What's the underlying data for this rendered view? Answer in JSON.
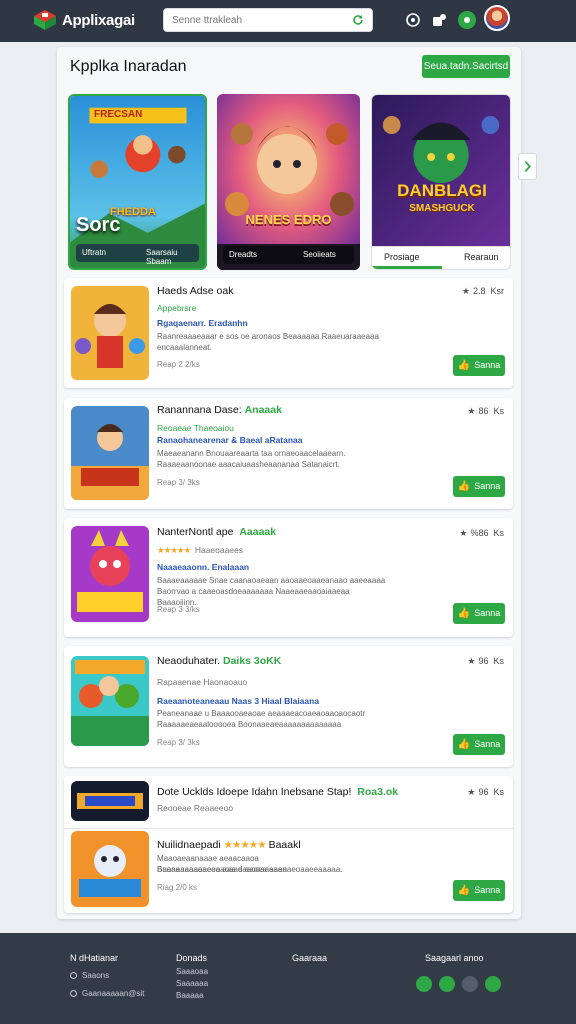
{
  "header": {
    "brand": "Applixagai",
    "search_placeholder": "Senne ttrakleah"
  },
  "main": {
    "title": "Kpplka Inaradan",
    "top_button": "Seua.tadn.Sacirtsd"
  },
  "featured": [
    {
      "banner": "FRECSAN",
      "logo": "FHEDDA",
      "big_text": "Sorc",
      "caption_left": "Uftratn",
      "caption_right": "Saarsaiu Sbaam"
    },
    {
      "logo": "NENES EDRO",
      "caption_left": "Dreadts",
      "caption_right": "Seoiieats"
    },
    {
      "logo_top": "DANBLAGI",
      "logo_bottom": "SMASHGUCK",
      "tab_active": "Prosiage",
      "tab_other": "Rearaun"
    }
  ],
  "apps": [
    {
      "name": "Haeds Adse oak",
      "highlight": "",
      "green": "Appebrsre",
      "blue": "Rgaqaenarr. Eradanhn",
      "desc1": "Raanreaaaeaaar e sos oe aronaos Beaaaaaa Raaeuaraaeaaa",
      "desc2": "encaaalanneat.",
      "size": "Reap 2 2/ks",
      "rating": "2.8",
      "rating_suffix": "Ksr",
      "button": "Sanna"
    },
    {
      "name": "Ranannana Dase:",
      "highlight": "Anaaak",
      "green": "Reoaeae  Thaeoaiou",
      "blue": "Ranaohanearenar & Baeal aRatanaa",
      "desc1": "Maeaeanann Bnouaareaarta taa ornaeoaacelaaearn.",
      "desc2": "Raaaeaanoonae aaacaiuaasheaananaa Satanaicrt.",
      "size": "Reap 3/ 3ks",
      "rating": "86",
      "rating_suffix": "Ks",
      "button": "Sanna"
    },
    {
      "name": "NanterNontl ape",
      "highlight": "Aaaaak",
      "stars_text": "★★★★★",
      "green": "Haaeoaaees",
      "blue": "Naaaeaaonn. Enalaaan",
      "desc1": "Baaaeaaaaae Snae caanaoaeaan aaoaaeoaaeanaao aaeeaaaa",
      "desc2": "Baorrvao a caaeoasdoeaaaaaaa Naaeaaeaaoaiaaeaa Baaaoiiinn.",
      "size": "Reap 3 3/ks",
      "rating": "%86",
      "rating_suffix": "Ks",
      "button": "Sanna"
    },
    {
      "name": "Neaoduhater.",
      "highlight": "Daiks 3oKK",
      "green": "Rapaaenae  Haonaoauo",
      "blue": "Raeaanoteaneaau  Naas 3 Hiaal Blaiaana",
      "desc1": "Peaneanaae u Baaaooaeaoae aeaaaeacoaeaoaaoaocaotr",
      "desc2": "Raaaaaeaeaalooooea  Boonaaeaeaaaaaaaaaaaaaa",
      "size": "Reap 3/ 3ks",
      "rating": "96",
      "rating_suffix": "Ks",
      "button": "Sanna"
    }
  ],
  "combo": {
    "top_name": "Dote Ucklds Idoepe Idahn Inebsane Stap!",
    "top_highlight": "Roa3.ok",
    "top_sub": "Reooeae  Reaaeeoo",
    "top_rating": "96",
    "top_rating_suffix": "Ks",
    "bottom_name": "Nuilidnaepadi",
    "bottom_stars": "★★★★★",
    "bottom_after": "Baaakl",
    "desc1": "Maaoaeaanaaae aeaacaaoa Baoneaaaaoaeeaaoaaeaaooaaeaan",
    "desc2": "Buaaaaaaaaaeoo aaa d aaoea aaeaaeoaaeeaaaaa.",
    "size": "Riag 2/0 ks",
    "button": "Sanna"
  },
  "footer": {
    "col1_title": "N dHatianar",
    "col1_links": [
      "Saaons",
      "Gaanaaaaan@sit"
    ],
    "col2_title": "Donads",
    "col2_links": [
      "Saaaoaa",
      "Saaaaaa",
      "Baaaaa"
    ],
    "col3_title": "Gaaraaa",
    "col4_title": "Saagaarl anoo"
  },
  "colors": {
    "accent": "#2ea845",
    "topbar": "#2f3744",
    "footer": "#333b47",
    "link_blue": "#2a56b8"
  }
}
